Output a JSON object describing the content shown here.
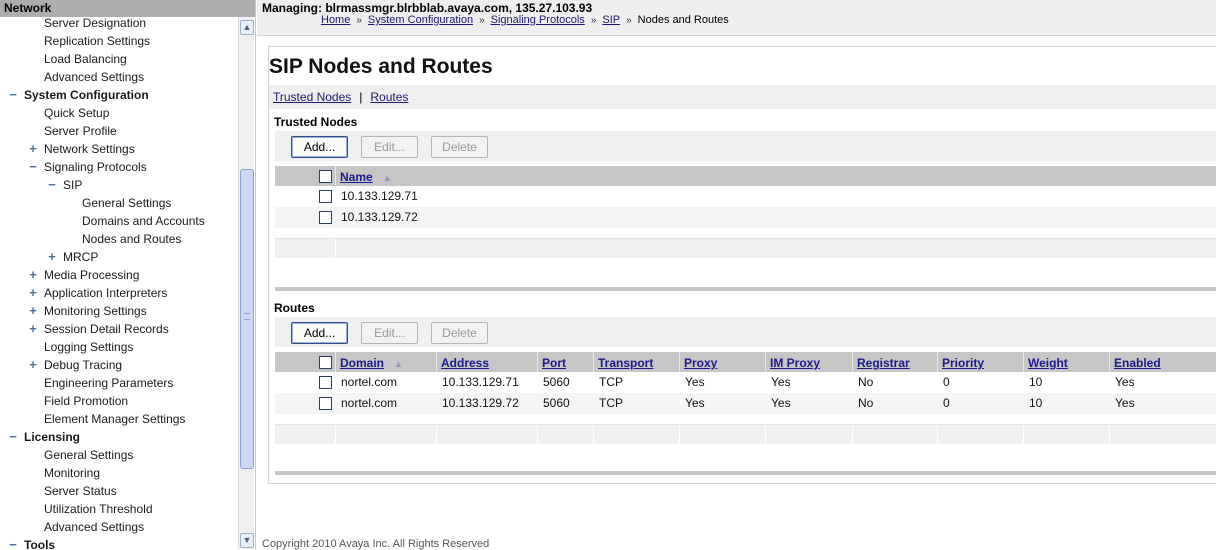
{
  "nav": {
    "header": "Network",
    "items": [
      {
        "label": "Server Designation",
        "indent": 44,
        "toggle": ""
      },
      {
        "label": "Replication Settings",
        "indent": 44,
        "toggle": ""
      },
      {
        "label": "Load Balancing",
        "indent": 44,
        "toggle": ""
      },
      {
        "label": "Advanced Settings",
        "indent": 44,
        "toggle": ""
      },
      {
        "label": "System Configuration",
        "indent": 24,
        "toggle": "−",
        "bold": true
      },
      {
        "label": "Quick Setup",
        "indent": 44,
        "toggle": ""
      },
      {
        "label": "Server Profile",
        "indent": 44,
        "toggle": ""
      },
      {
        "label": "Network Settings",
        "indent": 44,
        "toggle": "+"
      },
      {
        "label": "Signaling Protocols",
        "indent": 44,
        "toggle": "−"
      },
      {
        "label": "SIP",
        "indent": 63,
        "toggle": "−"
      },
      {
        "label": "General Settings",
        "indent": 82,
        "toggle": ""
      },
      {
        "label": "Domains and Accounts",
        "indent": 82,
        "toggle": ""
      },
      {
        "label": "Nodes and Routes",
        "indent": 82,
        "toggle": ""
      },
      {
        "label": "MRCP",
        "indent": 63,
        "toggle": "+"
      },
      {
        "label": "Media Processing",
        "indent": 44,
        "toggle": "+"
      },
      {
        "label": "Application Interpreters",
        "indent": 44,
        "toggle": "+"
      },
      {
        "label": "Monitoring Settings",
        "indent": 44,
        "toggle": "+"
      },
      {
        "label": "Session Detail Records",
        "indent": 44,
        "toggle": "+"
      },
      {
        "label": "Logging Settings",
        "indent": 44,
        "toggle": ""
      },
      {
        "label": "Debug Tracing",
        "indent": 44,
        "toggle": "+"
      },
      {
        "label": "Engineering Parameters",
        "indent": 44,
        "toggle": ""
      },
      {
        "label": "Field Promotion",
        "indent": 44,
        "toggle": ""
      },
      {
        "label": "Element Manager Settings",
        "indent": 44,
        "toggle": ""
      },
      {
        "label": "Licensing",
        "indent": 24,
        "toggle": "−",
        "bold": true
      },
      {
        "label": "General Settings",
        "indent": 44,
        "toggle": ""
      },
      {
        "label": "Monitoring",
        "indent": 44,
        "toggle": ""
      },
      {
        "label": "Server Status",
        "indent": 44,
        "toggle": ""
      },
      {
        "label": "Utilization Threshold",
        "indent": 44,
        "toggle": ""
      },
      {
        "label": "Advanced Settings",
        "indent": 44,
        "toggle": ""
      },
      {
        "label": "Tools",
        "indent": 24,
        "toggle": "−",
        "bold": true
      }
    ],
    "scroll_up": "▲",
    "scroll_down": "▼"
  },
  "top": {
    "managing": "Managing: blrmassmgr.blrbblab.avaya.com, 135.27.103.93",
    "breadcrumbs": [
      "Home",
      "System Configuration",
      "Signaling Protocols",
      "SIP"
    ],
    "current": "Nodes and Routes",
    "separator": "»"
  },
  "page": {
    "title": "SIP Nodes and Routes",
    "subnav": {
      "trusted": "Trusted Nodes",
      "pipe": "|",
      "routes": "Routes"
    }
  },
  "buttons": {
    "add": "Add...",
    "edit": "Edit...",
    "delete": "Delete"
  },
  "trusted": {
    "title": "Trusted Nodes",
    "header_name": "Name",
    "sort_icon": "▲",
    "rows": [
      "10.133.129.71",
      "10.133.129.72"
    ]
  },
  "routes": {
    "title": "Routes",
    "headers": {
      "domain": "Domain",
      "address": "Address",
      "port": "Port",
      "transport": "Transport",
      "proxy": "Proxy",
      "im_proxy": "IM Proxy",
      "registrar": "Registrar",
      "priority": "Priority",
      "weight": "Weight",
      "enabled": "Enabled"
    },
    "sort_icon": "▲",
    "rows": [
      {
        "domain": "nortel.com",
        "address": "10.133.129.71",
        "port": "5060",
        "transport": "TCP",
        "proxy": "Yes",
        "im_proxy": "Yes",
        "registrar": "No",
        "priority": "0",
        "weight": "10",
        "enabled": "Yes"
      },
      {
        "domain": "nortel.com",
        "address": "10.133.129.72",
        "port": "5060",
        "transport": "TCP",
        "proxy": "Yes",
        "im_proxy": "Yes",
        "registrar": "No",
        "priority": "0",
        "weight": "10",
        "enabled": "Yes"
      }
    ]
  },
  "footer": "Copyright 2010 Avaya Inc. All Rights Reserved"
}
